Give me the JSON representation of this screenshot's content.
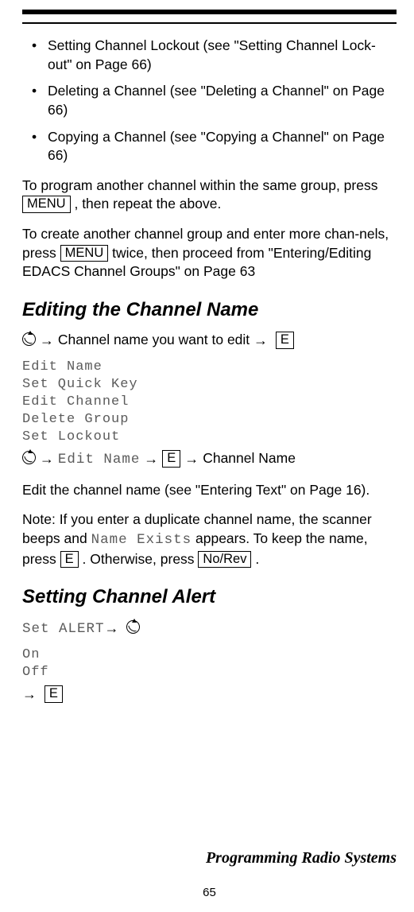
{
  "bullets": [
    "Setting Channel Lockout (see \"Setting Channel Lock-out\" on Page 66)",
    "Deleting a Channel (see \"Deleting a Channel\" on Page 66)",
    "Copying a Channel (see \"Copying a Channel\" on Page 66)"
  ],
  "paragraph1_a": "To program another channel within the same group, press ",
  "paragraph1_b": " , then repeat the above.",
  "paragraph2_a": "To create another channel group and enter more chan-nels, press ",
  "paragraph2_b": " twice, then proceed from \"Entering/Editing EDACS Channel Groups\" on Page 63",
  "keys": {
    "menu": "MENU",
    "e": "E",
    "norev": "No/Rev"
  },
  "section1": {
    "heading": "Editing the Channel Name",
    "flow1_mid": " Channel name you want to edit ",
    "menu_items": [
      "Edit Name",
      "Set Quick Key",
      "Edit Channel",
      "Delete Group",
      "Set Lockout"
    ],
    "flow2_lcd": "Edit Name",
    "flow2_end": " Channel Name",
    "para1": "Edit the channel name (see \"Entering Text\" on Page 16).",
    "note_a": "Note: If you enter a duplicate channel name, the scanner beeps and ",
    "note_lcd": "Name Exists",
    "note_b": " appears. To keep the name, press ",
    "note_c": " . Otherwise, press ",
    "note_d": " ."
  },
  "section2": {
    "heading": "Setting Channel Alert",
    "flow_lcd": "Set ALERT",
    "options": [
      "On",
      "Off"
    ]
  },
  "footer": {
    "title": "Programming Radio Systems",
    "page": "65"
  }
}
